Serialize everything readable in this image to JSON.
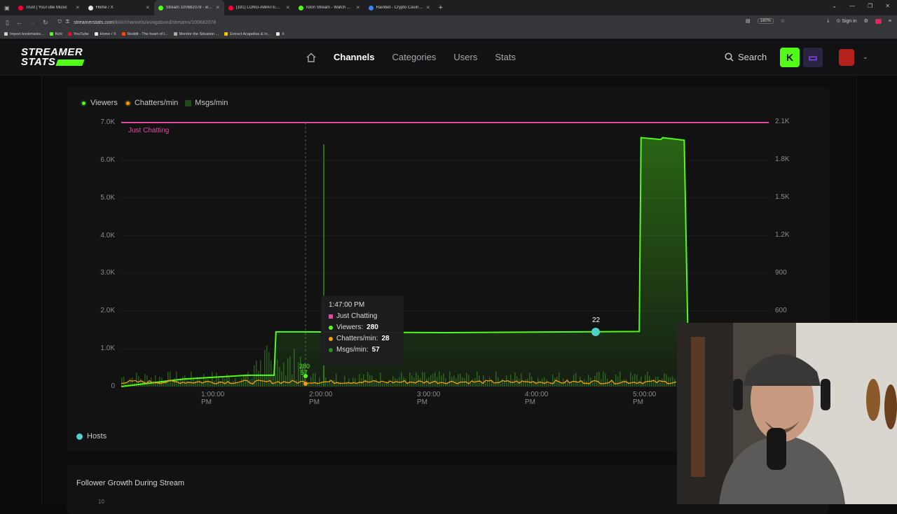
{
  "browser": {
    "tabs": [
      {
        "title": "Trust | YouTube Music",
        "color": "#ff0033"
      },
      {
        "title": "Home / X",
        "color": "#e6e6e6"
      },
      {
        "title": "Stream 100682078 - wvagabon",
        "color": "#53fc18",
        "active": true
      },
      {
        "title": "(191) LONG-AWAITED WIN | Dr",
        "color": "#ff0033"
      },
      {
        "title": "n3on Stream - Watch Live on K",
        "color": "#53fc18"
      },
      {
        "title": "Rainbet - Crypto Casino & Spo",
        "color": "#3b82f6"
      }
    ],
    "new_tab": "+",
    "url_host": "streamerstats.com",
    "url_path": "/kick/channels/wvagabond/streams/100682078",
    "zoom": "180%",
    "signin": "Sign in",
    "bookmarks": [
      {
        "label": "Import bookmarks...",
        "color": "#cfcfcf"
      },
      {
        "label": "Kick",
        "color": "#53fc18"
      },
      {
        "label": "YouTube",
        "color": "#ff0033"
      },
      {
        "label": "Home / X",
        "color": "#e6e6e6"
      },
      {
        "label": "Reddit - The heart of t...",
        "color": "#ff4500"
      },
      {
        "label": "Monitor the Situation ...",
        "color": "#aaaaaa"
      },
      {
        "label": "Extract Acapellas & In...",
        "color": "#f5c400"
      },
      {
        "label": "X",
        "color": "#e6e6e6"
      }
    ]
  },
  "site": {
    "logo_line1": "STREAMER",
    "logo_line2": "STATS",
    "nav": [
      "Channels",
      "Categories",
      "Users",
      "Stats"
    ],
    "search_label": "Search"
  },
  "chart_legend": {
    "viewers": "Viewers",
    "chatters": "Chatters/min",
    "msgs": "Msgs/min"
  },
  "colors": {
    "viewers": "#53fc18",
    "chatters": "#f59e0b",
    "msgs": "#214a1a",
    "category": "#e04aa3",
    "hosts": "#4fd1c5"
  },
  "chart_data": {
    "type": "line",
    "x_ticks": [
      "1:00:00 PM",
      "2:00:00 PM",
      "3:00:00 PM",
      "4:00:00 PM",
      "5:00:00 PM"
    ],
    "y_left_ticks": [
      "0",
      "1.0K",
      "2.0K",
      "3.0K",
      "4.0K",
      "5.0K",
      "6.0K",
      "7.0K"
    ],
    "y_right_ticks": [
      "600",
      "900",
      "1.2K",
      "1.5K",
      "1.8K",
      "2.1K"
    ],
    "ylim_left": [
      0,
      7000
    ],
    "category_band": "Just Chatting",
    "series": [
      {
        "name": "Viewers",
        "x_minutes": [
          0,
          35,
          70,
          85,
          86,
          100,
          180,
          288,
          289,
          300,
          301,
          313,
          315
        ],
        "values": [
          0,
          200,
          300,
          300,
          1450,
          1450,
          1430,
          1460,
          6600,
          6550,
          6600,
          6530,
          1500
        ]
      },
      {
        "name": "Chatters/min",
        "x_minutes": [
          0,
          60,
          85,
          120,
          200,
          300
        ],
        "values": [
          50,
          100,
          28,
          60,
          50,
          60
        ]
      }
    ],
    "tooltip": {
      "time": "1:47:00 PM",
      "category": "Just Chatting",
      "viewers_label": "Viewers:",
      "viewers": "280",
      "chatters_label": "Chatters/min:",
      "chatters": "28",
      "msgs_label": "Msgs/min:",
      "msgs": "57"
    },
    "hover_label_viewers": "280",
    "hover_label_msgs": "57",
    "host_marker_label": "22"
  },
  "hosts_label": "Hosts",
  "follower_title": "Follower Growth During Stream",
  "follower_tick": "10"
}
